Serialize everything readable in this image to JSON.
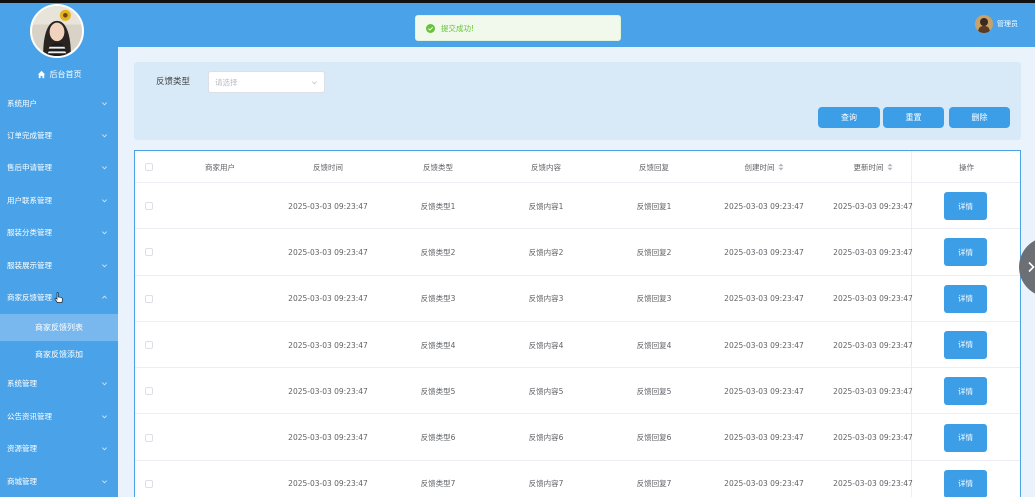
{
  "sidebar": {
    "home_label": "后台首页",
    "items": [
      {
        "label": "系统用户",
        "expanded": false
      },
      {
        "label": "订单完成管理",
        "expanded": false
      },
      {
        "label": "售后申请管理",
        "expanded": false
      },
      {
        "label": "用户联系管理",
        "expanded": false
      },
      {
        "label": "服装分类管理",
        "expanded": false
      },
      {
        "label": "服装展示管理",
        "expanded": false
      },
      {
        "label": "商家反馈管理",
        "expanded": true
      },
      {
        "label": "商家反馈列表",
        "sub": true,
        "active": true
      },
      {
        "label": "商家反馈添加",
        "sub": true,
        "active": false
      },
      {
        "label": "系统管理",
        "expanded": false
      },
      {
        "label": "公告资讯管理",
        "expanded": false
      },
      {
        "label": "资源管理",
        "expanded": false
      },
      {
        "label": "商城管理",
        "expanded": false
      }
    ]
  },
  "header": {
    "user_name": "管理员"
  },
  "toast": {
    "message": "提交成功!",
    "type": "success"
  },
  "search": {
    "type_label": "反馈类型",
    "type_placeholder": "请选择",
    "query_label": "查询",
    "reset_label": "重置",
    "delete_label": "删除"
  },
  "table": {
    "columns": [
      "商家用户",
      "反馈时间",
      "反馈类型",
      "反馈内容",
      "反馈回复",
      "创建时间",
      "更新时间",
      "操作"
    ],
    "sortable_columns": [
      "创建时间",
      "更新时间"
    ],
    "rows": [
      {
        "user": "",
        "time": "2025-03-03 09:23:47",
        "type": "反馈类型1",
        "content": "反馈内容1",
        "reply": "反馈回复1",
        "created": "2025-03-03 09:23:47",
        "updated": "2025-03-03 09:23:47",
        "action": "详情"
      },
      {
        "user": "",
        "time": "2025-03-03 09:23:47",
        "type": "反馈类型2",
        "content": "反馈内容2",
        "reply": "反馈回复2",
        "created": "2025-03-03 09:23:47",
        "updated": "2025-03-03 09:23:47",
        "action": "详情"
      },
      {
        "user": "",
        "time": "2025-03-03 09:23:47",
        "type": "反馈类型3",
        "content": "反馈内容3",
        "reply": "反馈回复3",
        "created": "2025-03-03 09:23:47",
        "updated": "2025-03-03 09:23:47",
        "action": "详情"
      },
      {
        "user": "",
        "time": "2025-03-03 09:23:47",
        "type": "反馈类型4",
        "content": "反馈内容4",
        "reply": "反馈回复4",
        "created": "2025-03-03 09:23:47",
        "updated": "2025-03-03 09:23:47",
        "action": "详情"
      },
      {
        "user": "",
        "time": "2025-03-03 09:23:47",
        "type": "反馈类型5",
        "content": "反馈内容5",
        "reply": "反馈回复5",
        "created": "2025-03-03 09:23:47",
        "updated": "2025-03-03 09:23:47",
        "action": "详情"
      },
      {
        "user": "",
        "time": "2025-03-03 09:23:47",
        "type": "反馈类型6",
        "content": "反馈内容6",
        "reply": "反馈回复6",
        "created": "2025-03-03 09:23:47",
        "updated": "2025-03-03 09:23:47",
        "action": "详情"
      },
      {
        "user": "",
        "time": "2025-03-03 09:23:47",
        "type": "反馈类型7",
        "content": "反馈内容7",
        "reply": "反馈回复7",
        "created": "2025-03-03 09:23:47",
        "updated": "2025-03-03 09:23:47",
        "action": "详情"
      }
    ]
  },
  "colors": {
    "primary": "#4aa3e8",
    "button": "#3d9ee8",
    "success": "#67c23a",
    "panel": "#d8e9f8"
  }
}
